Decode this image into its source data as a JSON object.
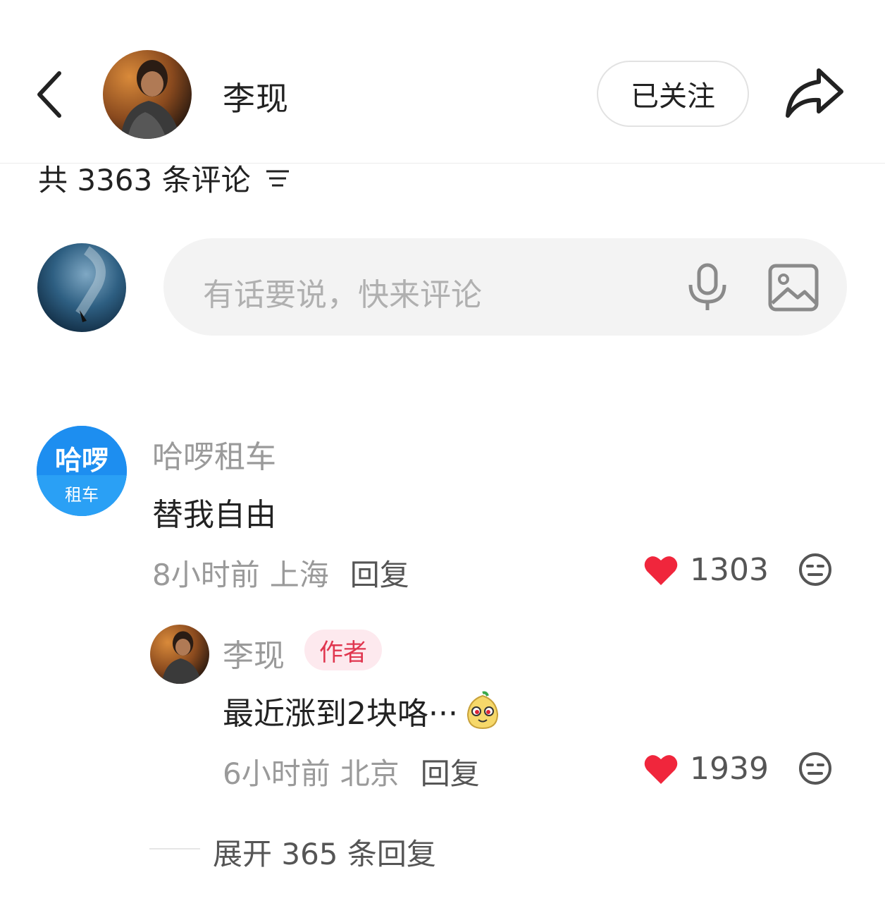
{
  "header": {
    "username": "李现",
    "follow_label": "已关注"
  },
  "comments_summary": {
    "count_text": "共 3363 条评论"
  },
  "composer": {
    "placeholder": "有话要说，快来评论"
  },
  "comments": [
    {
      "author": "哈啰租车",
      "avatar_text_1": "哈啰",
      "avatar_text_2": "租车",
      "text": "替我自由",
      "time": "8小时前",
      "location": "上海",
      "reply_label": "回复",
      "likes": "1303",
      "replies": [
        {
          "author": "李现",
          "badge": "作者",
          "text": "最近涨到2块咯···",
          "emoji": "smiling-pear-emoji",
          "time": "6小时前",
          "location": "北京",
          "reply_label": "回复",
          "likes": "1939"
        }
      ],
      "expand_label": "展开 365 条回复"
    }
  ],
  "colors": {
    "heart": "#f0263c",
    "badge_bg": "#fde9ee",
    "badge_text": "#e0364f",
    "brand_blue": "#1d8ef0"
  }
}
